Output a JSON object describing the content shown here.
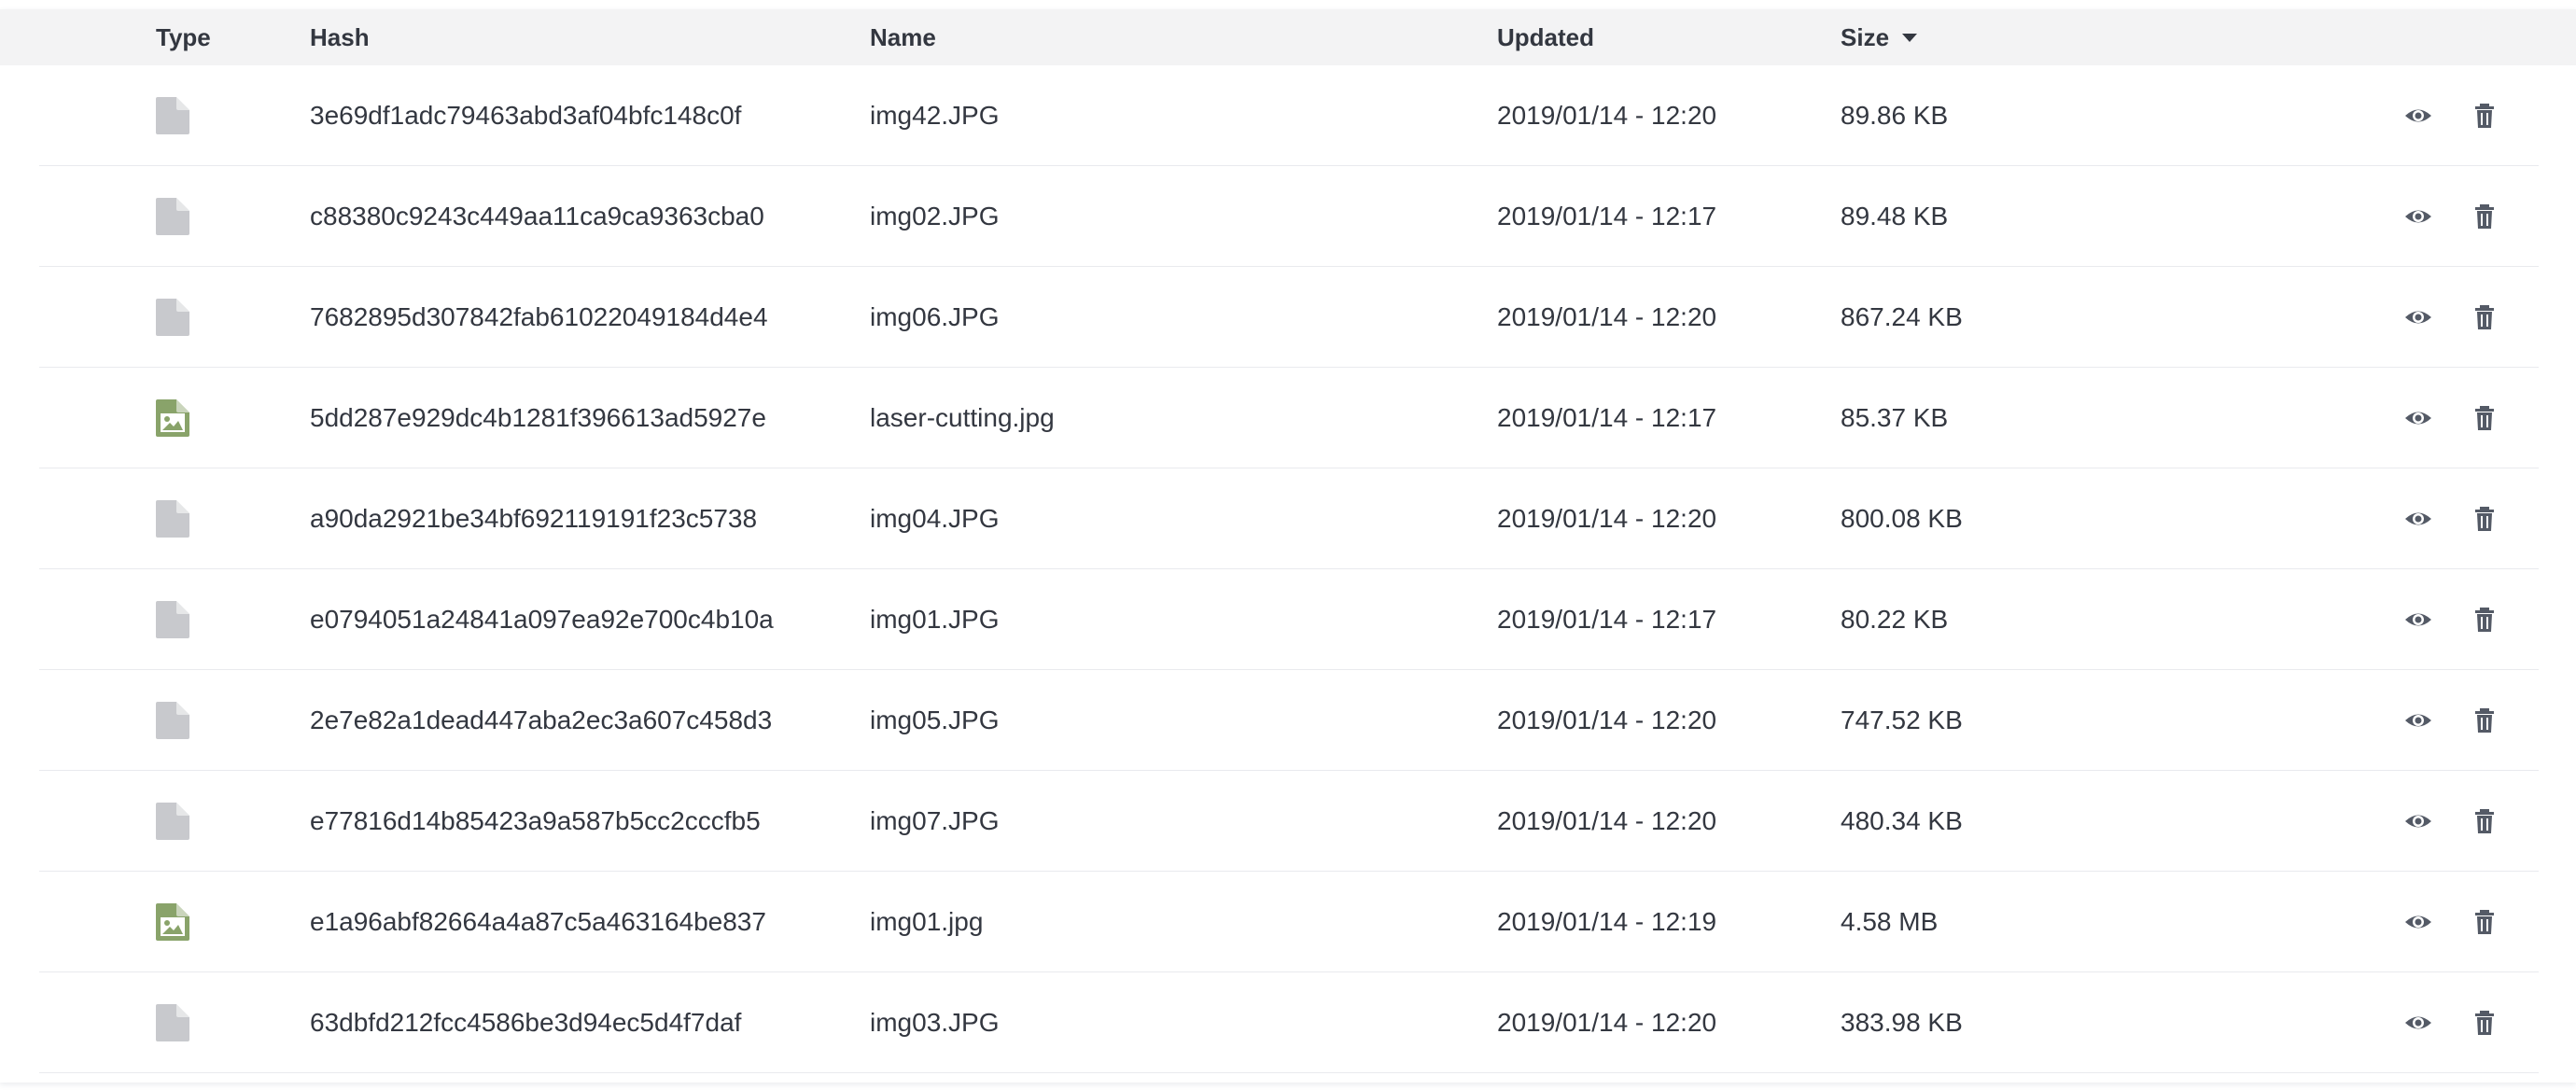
{
  "colors": {
    "header_bg": "#f3f3f4",
    "text": "#333740",
    "file_icon": "#c8c9cd",
    "image_icon": "#89a36a",
    "action_icon": "#545a66",
    "row_divider": "#e9eaee"
  },
  "columns": {
    "type": "Type",
    "hash": "Hash",
    "name": "Name",
    "updated": "Updated",
    "size": "Size"
  },
  "sort": {
    "column": "size",
    "direction": "desc"
  },
  "rows": [
    {
      "type": "file",
      "icon": "file-icon",
      "hash": "3e69df1adc79463abd3af04bfc148c0f",
      "name": "img42.JPG",
      "updated": "2019/01/14 - 12:20",
      "size": "89.86 KB"
    },
    {
      "type": "file",
      "icon": "file-icon",
      "hash": "c88380c9243c449aa11ca9ca9363cba0",
      "name": "img02.JPG",
      "updated": "2019/01/14 - 12:17",
      "size": "89.48 KB"
    },
    {
      "type": "file",
      "icon": "file-icon",
      "hash": "7682895d307842fab61022049184d4e4",
      "name": "img06.JPG",
      "updated": "2019/01/14 - 12:20",
      "size": "867.24 KB"
    },
    {
      "type": "image",
      "icon": "image-file-icon",
      "hash": "5dd287e929dc4b1281f396613ad5927e",
      "name": "laser-cutting.jpg",
      "updated": "2019/01/14 - 12:17",
      "size": "85.37 KB"
    },
    {
      "type": "file",
      "icon": "file-icon",
      "hash": "a90da2921be34bf692119191f23c5738",
      "name": "img04.JPG",
      "updated": "2019/01/14 - 12:20",
      "size": "800.08 KB"
    },
    {
      "type": "file",
      "icon": "file-icon",
      "hash": "e0794051a24841a097ea92e700c4b10a",
      "name": "img01.JPG",
      "updated": "2019/01/14 - 12:17",
      "size": "80.22 KB"
    },
    {
      "type": "file",
      "icon": "file-icon",
      "hash": "2e7e82a1dead447aba2ec3a607c458d3",
      "name": "img05.JPG",
      "updated": "2019/01/14 - 12:20",
      "size": "747.52 KB"
    },
    {
      "type": "file",
      "icon": "file-icon",
      "hash": "e77816d14b85423a9a587b5cc2cccfb5",
      "name": "img07.JPG",
      "updated": "2019/01/14 - 12:20",
      "size": "480.34 KB"
    },
    {
      "type": "image",
      "icon": "image-file-icon",
      "hash": "e1a96abf82664a4a87c5a463164be837",
      "name": "img01.jpg",
      "updated": "2019/01/14 - 12:19",
      "size": "4.58 MB"
    },
    {
      "type": "file",
      "icon": "file-icon",
      "hash": "63dbfd212fcc4586be3d94ec5d4f7daf",
      "name": "img03.JPG",
      "updated": "2019/01/14 - 12:20",
      "size": "383.98 KB"
    }
  ],
  "row_actions": [
    "eye-icon",
    "trash-icon"
  ]
}
